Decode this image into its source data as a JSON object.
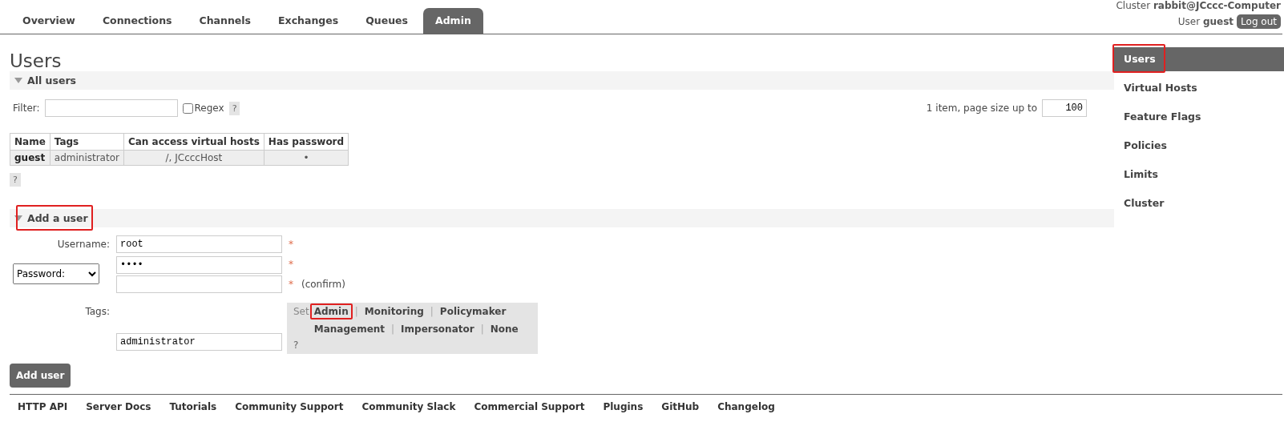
{
  "tabs": [
    {
      "label": "Overview",
      "selected": false
    },
    {
      "label": "Connections",
      "selected": false
    },
    {
      "label": "Channels",
      "selected": false
    },
    {
      "label": "Exchanges",
      "selected": false
    },
    {
      "label": "Queues",
      "selected": false
    },
    {
      "label": "Admin",
      "selected": true
    }
  ],
  "header": {
    "cluster_label": "Cluster",
    "cluster_name": "rabbit@JCccc-Computer",
    "user_label": "User",
    "user_name": "guest",
    "logout": "Log out"
  },
  "page_title": "Users",
  "all_users": {
    "title": "All users",
    "expanded": true,
    "filter_label": "Filter:",
    "regex_label": "Regex",
    "regex_checked": false,
    "help": "?",
    "paging_text": "1 item, page size up to",
    "page_size": "100",
    "table": {
      "columns": [
        "Name",
        "Tags",
        "Can access virtual hosts",
        "Has password"
      ],
      "rows": [
        [
          "guest",
          "administrator",
          "/, JCcccHost",
          "•"
        ]
      ]
    },
    "table_help": "?"
  },
  "add_user": {
    "title": "Add a user",
    "expanded": true,
    "highlighted": true,
    "username_label": "Username:",
    "username": "root",
    "required_mark": "*",
    "password_mode": "Password:",
    "password": "••••",
    "confirm_label": "(confirm)",
    "tags_label": "Tags:",
    "set_label": "Set",
    "separator": "|",
    "tag_links": [
      {
        "label": "Admin",
        "highlighted": true
      },
      {
        "label": "Monitoring",
        "highlighted": false
      },
      {
        "label": "Policymaker",
        "highlighted": false
      },
      {
        "label": "Management",
        "highlighted": false
      },
      {
        "label": "Impersonator",
        "highlighted": false
      },
      {
        "label": "None",
        "highlighted": false
      }
    ],
    "tags_value": "administrator",
    "tags_help": "?",
    "submit": "Add user"
  },
  "sidebar": {
    "items": [
      {
        "label": "Users",
        "selected": true,
        "highlighted": true
      },
      {
        "label": "Virtual Hosts",
        "selected": false,
        "highlighted": false
      },
      {
        "label": "Feature Flags",
        "selected": false,
        "highlighted": false
      },
      {
        "label": "Policies",
        "selected": false,
        "highlighted": false
      },
      {
        "label": "Limits",
        "selected": false,
        "highlighted": false
      },
      {
        "label": "Cluster",
        "selected": false,
        "highlighted": false
      }
    ]
  },
  "footer": {
    "links": [
      "HTTP API",
      "Server Docs",
      "Tutorials",
      "Community Support",
      "Community Slack",
      "Commercial Support",
      "Plugins",
      "GitHub",
      "Changelog"
    ]
  }
}
